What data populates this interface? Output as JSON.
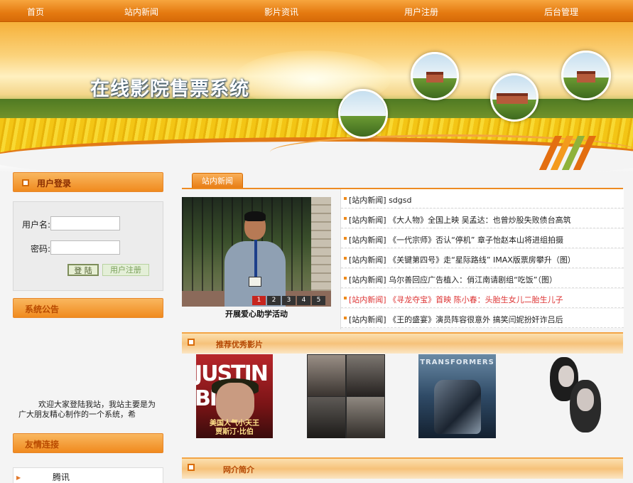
{
  "nav": {
    "items": [
      "首页",
      "站内新闻",
      "影片资讯",
      "用户注册",
      "后台管理"
    ]
  },
  "banner": {
    "site_title": "在线影院售票系统"
  },
  "colors": {
    "accent": "#ed8b22",
    "nav_bg": "#e57a10",
    "highlight_news": "#dd3333",
    "pager_active": "#c7251e"
  },
  "login": {
    "title": "用户登录",
    "username_label": "用户名:",
    "password_label": "密码:",
    "username_value": "",
    "password_value": "",
    "login_button": "登 陆",
    "register_button": "用户注册"
  },
  "notice": {
    "title": "系统公告",
    "text": "欢迎大家登陆我站，我站主要是为广大朋友精心制作的一个系统，希"
  },
  "links": {
    "title": "友情连接",
    "items": [
      "腾讯"
    ]
  },
  "news": {
    "tab_label": "站内新闻",
    "slideshow": {
      "caption": "开展爱心助学活动",
      "pages": [
        "1",
        "2",
        "3",
        "4",
        "5"
      ],
      "active_page": "1"
    },
    "items": [
      {
        "text": "[站内新闻] sdgsd",
        "highlight": false
      },
      {
        "text": "[站内新闻] 《大人物》全国上映 吴孟达：也曾炒股失败债台高筑",
        "highlight": false
      },
      {
        "text": "[站内新闻] 《一代宗师》否认“停机” 章子怡赵本山将进组拍摄",
        "highlight": false
      },
      {
        "text": "[站内新闻] 《关键第四号》走“星际路线” IMAX版票房攀升（图）",
        "highlight": false
      },
      {
        "text": "[站内新闻] 乌尔善回应广告植入：俏江南请剧组“吃饭”（图）",
        "highlight": false
      },
      {
        "text": "[站内新闻] 《寻龙夺宝》首映 陈小春：头胎生女儿二胎生儿子",
        "highlight": true
      },
      {
        "text": "[站内新闻] 《王的盛宴》演员阵容很意外 搞笑闫妮扮奸诈吕后",
        "highlight": false
      }
    ]
  },
  "recommend": {
    "title": "推荐优秀影片",
    "posters": [
      {
        "icon": "poster-justin-bieber",
        "top_text": "JUSTIN BIE",
        "caption_line1": "美国人气小天王",
        "caption_line2": "贾斯汀·比伯"
      },
      {
        "icon": "poster-ensemble-cast"
      },
      {
        "icon": "poster-transformers",
        "top_text": "TRANSFORMERS"
      },
      {
        "icon": "poster-portrait-couple"
      }
    ]
  },
  "about": {
    "title": "网介简介"
  }
}
